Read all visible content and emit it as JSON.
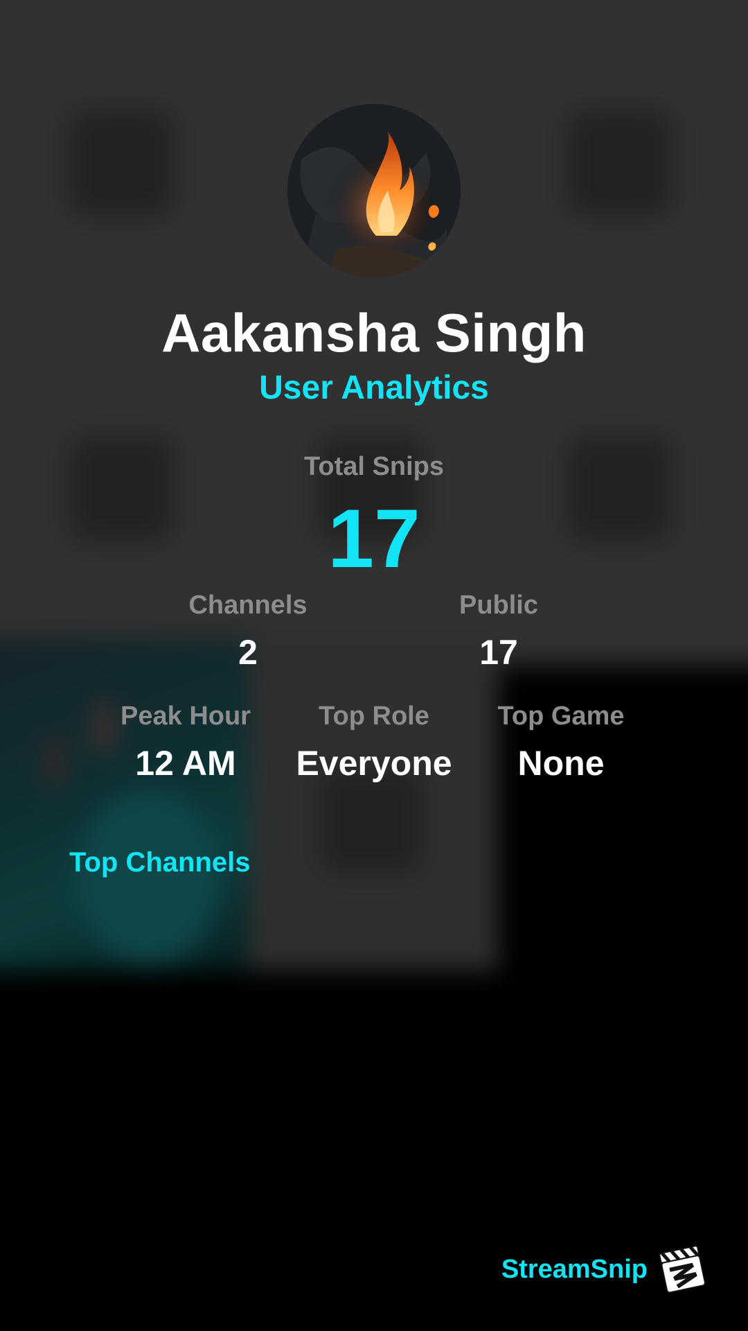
{
  "profile": {
    "name": "Aakansha Singh",
    "subtitle": "User Analytics",
    "avatar_icon": "campfire-avatar"
  },
  "stats": {
    "total_snips": {
      "label": "Total Snips",
      "value": "17"
    },
    "channels": {
      "label": "Channels",
      "value": "2"
    },
    "public": {
      "label": "Public",
      "value": "17"
    },
    "peak_hour": {
      "label": "Peak Hour",
      "value": "12 AM"
    },
    "top_role": {
      "label": "Top Role",
      "value": "Everyone"
    },
    "top_game": {
      "label": "Top Game",
      "value": "None"
    }
  },
  "sections": {
    "top_channels_title": "Top Channels"
  },
  "branding": {
    "name": "StreamSnip",
    "logo_icon": "clapperboard-icon"
  },
  "colors": {
    "accent": "#12e4f5",
    "label_gray": "#8d8d8d",
    "background": "#000000"
  }
}
